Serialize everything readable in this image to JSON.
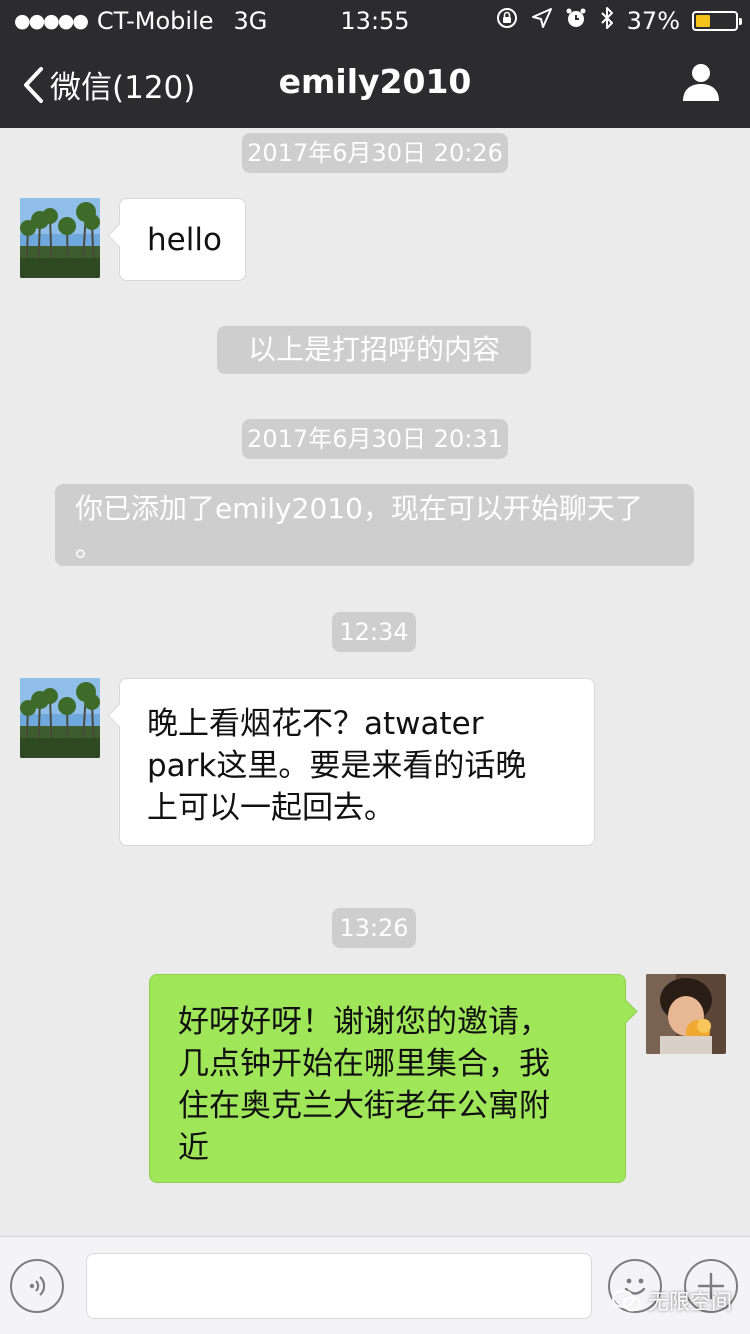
{
  "status_bar": {
    "carrier": "CT-Mobile",
    "network": "3G",
    "time": "13:55",
    "battery": "37%",
    "battery_level": 0.37
  },
  "nav": {
    "back_label": "微信(120)",
    "title": "emily2010"
  },
  "messages": {
    "ts1": "2017年6月30日 20:26",
    "msg1": "hello",
    "system1": "以上是打招呼的内容",
    "ts2": "2017年6月30日 20:31",
    "system2_line1": "你已添加了emily2010，现在可以开始聊天了",
    "system2_line2": "。",
    "ts3": "12:34",
    "msg2_line1": "晚上看烟花不？atwater",
    "msg2_line2": "park这里。要是来看的话晚",
    "msg2_line3": "上可以一起回去。",
    "ts4": "13:26",
    "msg3_line1": "好呀好呀！谢谢您的邀请，",
    "msg3_line2": "几点钟开始在哪里集合，我",
    "msg3_line3": "住在奥克兰大街老年公寓附",
    "msg3_line4": "近"
  },
  "input": {
    "value": ""
  },
  "watermark": "无限空间",
  "colors": {
    "nav_bg": "#2c2c2e",
    "chat_bg": "#ebebeb",
    "outgoing_bubble": "#9fe658",
    "incoming_bubble": "#ffffff",
    "timestamp_pill": "#cecece",
    "battery": "#f3c31b"
  }
}
